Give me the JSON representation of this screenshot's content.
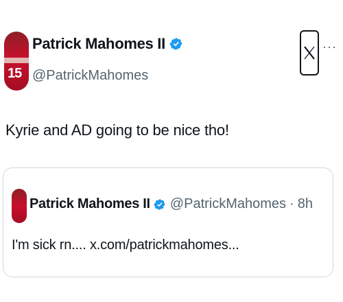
{
  "author": {
    "name": "Patrick Mahomes II",
    "handle": "@PatrickMahomes",
    "avatar_jersey": "15"
  },
  "tweet": {
    "text": "Kyrie and AD going to be nice tho!"
  },
  "quoted": {
    "name": "Patrick Mahomes II",
    "handle": "@PatrickMahomes",
    "separator": "·",
    "time": "8h",
    "text": "I'm sick rn.... x.com/patrickmahomes..."
  },
  "icons": {
    "verified": "verified-badge-icon",
    "brand": "x-logo-icon",
    "more": "more-options-icon"
  },
  "colors": {
    "verified": "#1d9bf0",
    "secondary_text": "#536471",
    "border": "#cfd9de",
    "avatar": "#c8102e"
  }
}
